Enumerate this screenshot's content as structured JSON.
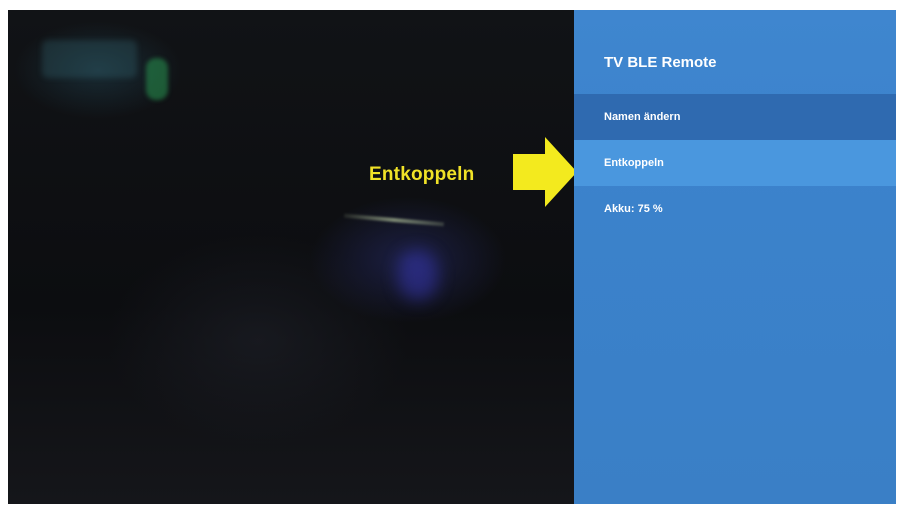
{
  "annotation": {
    "label": "Entkoppeln",
    "color": "#f0e227"
  },
  "panel": {
    "title": "TV BLE Remote",
    "menu_items": [
      {
        "label": "Namen ändern"
      },
      {
        "label": "Entkoppeln"
      }
    ],
    "battery": "Akku: 75 %",
    "accent": "#3f86cf",
    "selected_item_bg": "#2f6ab0"
  }
}
